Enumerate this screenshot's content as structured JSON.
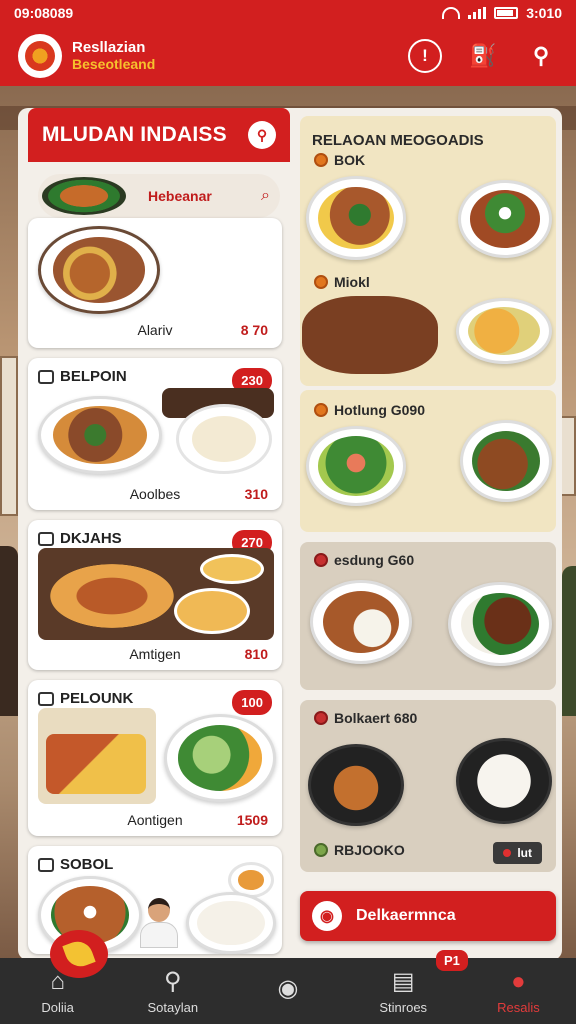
{
  "status": {
    "time": "09:08089",
    "clock": "3:010"
  },
  "header": {
    "brand_line1": "Resllazian",
    "brand_line2": "Beseotleand"
  },
  "left": {
    "title": "MLUDAN INDAISS",
    "search_placeholder": "Hebeanar",
    "cards": [
      {
        "category": "",
        "badge": "",
        "name": "Alariv",
        "price": "8 70"
      },
      {
        "category": "BELPOIN",
        "badge": "230",
        "name": "Aoolbes",
        "price": "310"
      },
      {
        "category": "DKJAHS",
        "badge": "270",
        "name": "Amtigen",
        "price": "810"
      },
      {
        "category": "PELOUNK",
        "badge": "100",
        "name": "Aontigen",
        "price": "1509"
      },
      {
        "category": "SOBOL",
        "badge": "",
        "name": "",
        "price": ""
      }
    ]
  },
  "right": {
    "title": "RELAOAN MEOGOADIS",
    "sections": [
      {
        "label": "BOK"
      },
      {
        "label": "Miokl"
      },
      {
        "label": "Hotlung G090"
      },
      {
        "label": "esdung G60"
      },
      {
        "label": "Bolkaert 680"
      },
      {
        "label": "RBJOOKO",
        "pill": "lut"
      }
    ],
    "cta": "Delkaermnca"
  },
  "nav": {
    "items": [
      {
        "label": "Doliia",
        "icon": "home-icon"
      },
      {
        "label": "Sotaylan",
        "icon": "search-icon"
      },
      {
        "label": "",
        "icon": "record-icon"
      },
      {
        "label": "Stinroes",
        "icon": "store-icon"
      },
      {
        "label": "Resalis",
        "icon": "profile-icon"
      }
    ],
    "badge": "P1"
  }
}
